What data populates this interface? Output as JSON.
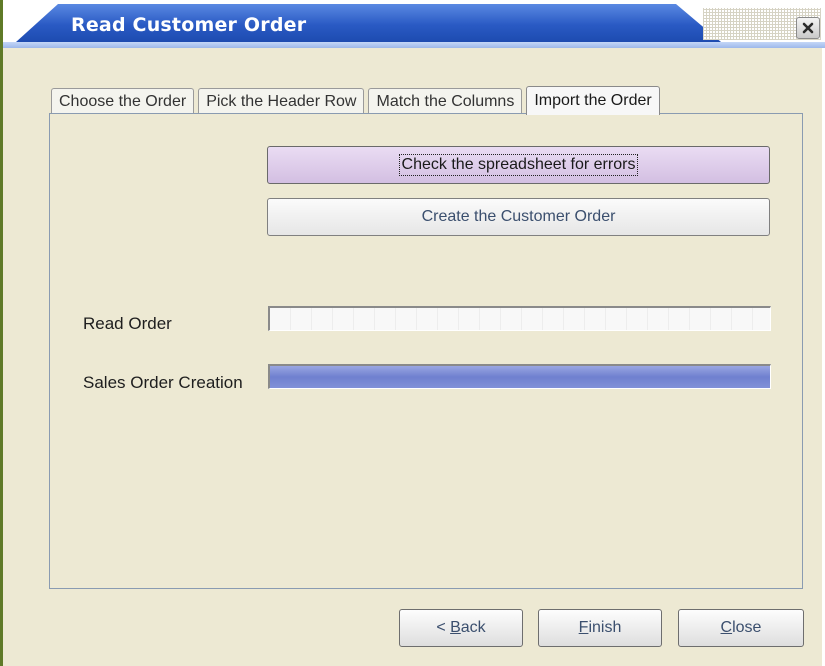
{
  "window": {
    "title": "Read Customer Order"
  },
  "tabs": [
    {
      "label": "Choose the Order"
    },
    {
      "label": "Pick the Header Row"
    },
    {
      "label": "Match the Columns"
    },
    {
      "label": "Import the Order",
      "active": true
    }
  ],
  "actions": {
    "check_label": "Check the spreadsheet for errors",
    "create_label": "Create the Customer Order"
  },
  "progress": {
    "read_order": {
      "label": "Read Order",
      "value": 0
    },
    "sales_order_creation": {
      "label": "Sales Order Creation",
      "value": 1.0
    }
  },
  "footer": {
    "back": {
      "prefix": "< ",
      "mnemonic": "B",
      "rest": "ack"
    },
    "finish": {
      "mnemonic": "F",
      "rest": "inish"
    },
    "close": {
      "mnemonic": "C",
      "rest": "lose"
    }
  },
  "colors": {
    "title_bar": "#2a5ac4",
    "window_bg": "#ede9d3",
    "progress_fill": "#6f80cf",
    "check_button": "#d3bfe2"
  },
  "icons": {
    "close": "close-icon"
  }
}
